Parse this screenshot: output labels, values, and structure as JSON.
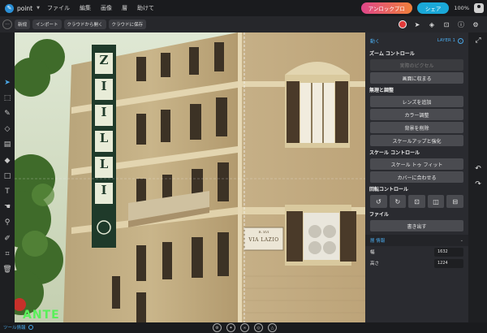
{
  "app": {
    "name": "point"
  },
  "menu": [
    "ファイル",
    "編集",
    "画像",
    "層",
    "助けて"
  ],
  "header": {
    "unlock_label": "アンロックプロ",
    "share_label": "シェア",
    "zoom": "100%"
  },
  "toolbar": {
    "new_label": "新规",
    "import_label": "インポート",
    "open_cloud_label": "クラウドから開く",
    "save_cloud_label": "クラウドに保存"
  },
  "panel": {
    "back_label": "動く",
    "layer_label": "LAYER 1",
    "zoom_title": "ズーム コントロール",
    "actual_pixels": "実際のピクセル",
    "fit_screen": "画面に収まる",
    "adjust_title": "無理と調整",
    "add_lens": "レンズを追加",
    "color_adjust": "カラー調整",
    "remove_bg": "背景を削除",
    "upscale": "スケールアップと強化",
    "scale_title": "スケール コントロール",
    "scale_fit": "スケール トゥ フィット",
    "fit_cover": "カバーに合わせる",
    "rotate_title": "回転コントロール",
    "file_title": "ファイル",
    "export": "書き出す",
    "info_title": "層 情報",
    "width_label": "幅",
    "width_value": "1632",
    "height_label": "高さ",
    "height_value": "1224"
  },
  "bottom": {
    "tool_info": "ツール情報"
  },
  "canvas": {
    "hotel_letters": [
      "Z",
      "I",
      "I",
      "L",
      "L",
      "I"
    ],
    "street_sign": "VIA LAZIO",
    "street_sign_small": "R. XVI",
    "bottom_text": "ANTE"
  },
  "colors": {
    "accent": "#4aa8e8",
    "share": "#1aa8d8",
    "record": "#e03a3a"
  }
}
